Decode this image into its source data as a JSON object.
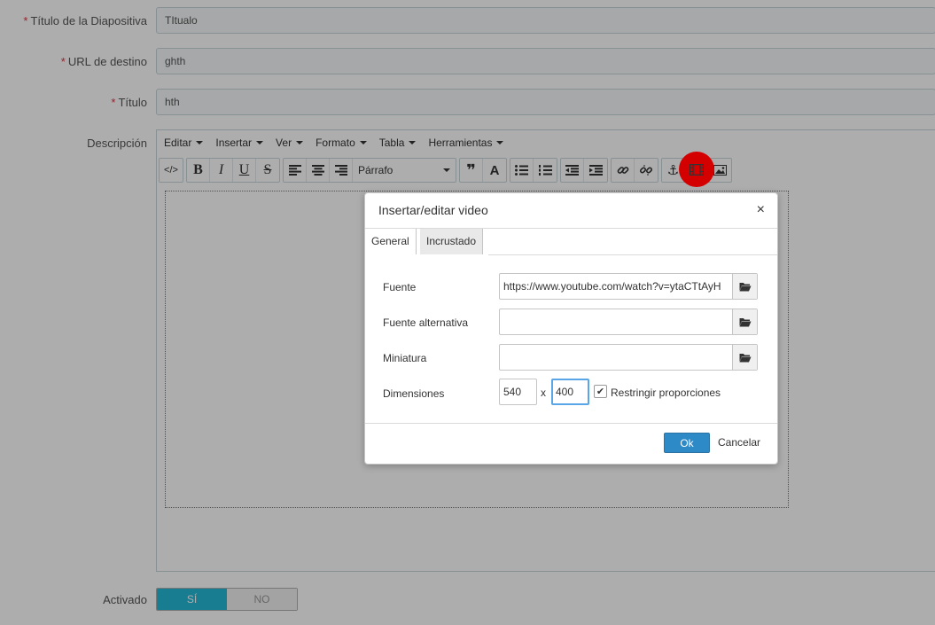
{
  "form": {
    "slide_title_label": "Título de la Diapositiva",
    "slide_title_value": "TItualo",
    "url_label": "URL de destino",
    "url_value": "ghth",
    "title_label": "Título",
    "title_value": "hth",
    "description_label": "Descripción",
    "required_mark": "*",
    "activated_label": "Activado",
    "toggle_yes": "SÍ",
    "toggle_no": "NO"
  },
  "editor": {
    "menu": [
      {
        "label": "Editar"
      },
      {
        "label": "Insertar"
      },
      {
        "label": "Ver"
      },
      {
        "label": "Formato"
      },
      {
        "label": "Tabla"
      },
      {
        "label": "Herramientas"
      }
    ],
    "format_select": "Párrafo"
  },
  "dialog": {
    "title": "Insertar/editar video",
    "close": "×",
    "tabs": [
      {
        "label": "General",
        "active": true
      },
      {
        "label": "Incrustado",
        "active": false
      }
    ],
    "source_label": "Fuente",
    "source_value": "https://www.youtube.com/watch?v=ytaCTtAyH",
    "alt_source_label": "Fuente alternativa",
    "alt_source_value": "",
    "poster_label": "Miniatura",
    "poster_value": "",
    "dimensions_label": "Dimensiones",
    "width": "540",
    "height": "400",
    "x_sep": "x",
    "constrain_label": "Restringir proporciones",
    "constrain_checked": true,
    "ok": "Ok",
    "cancel": "Cancelar"
  },
  "colors": {
    "accent": "#25b9d7",
    "primary_button": "#2d8ac7",
    "highlight": "#d40000",
    "required": "#e0323e"
  }
}
